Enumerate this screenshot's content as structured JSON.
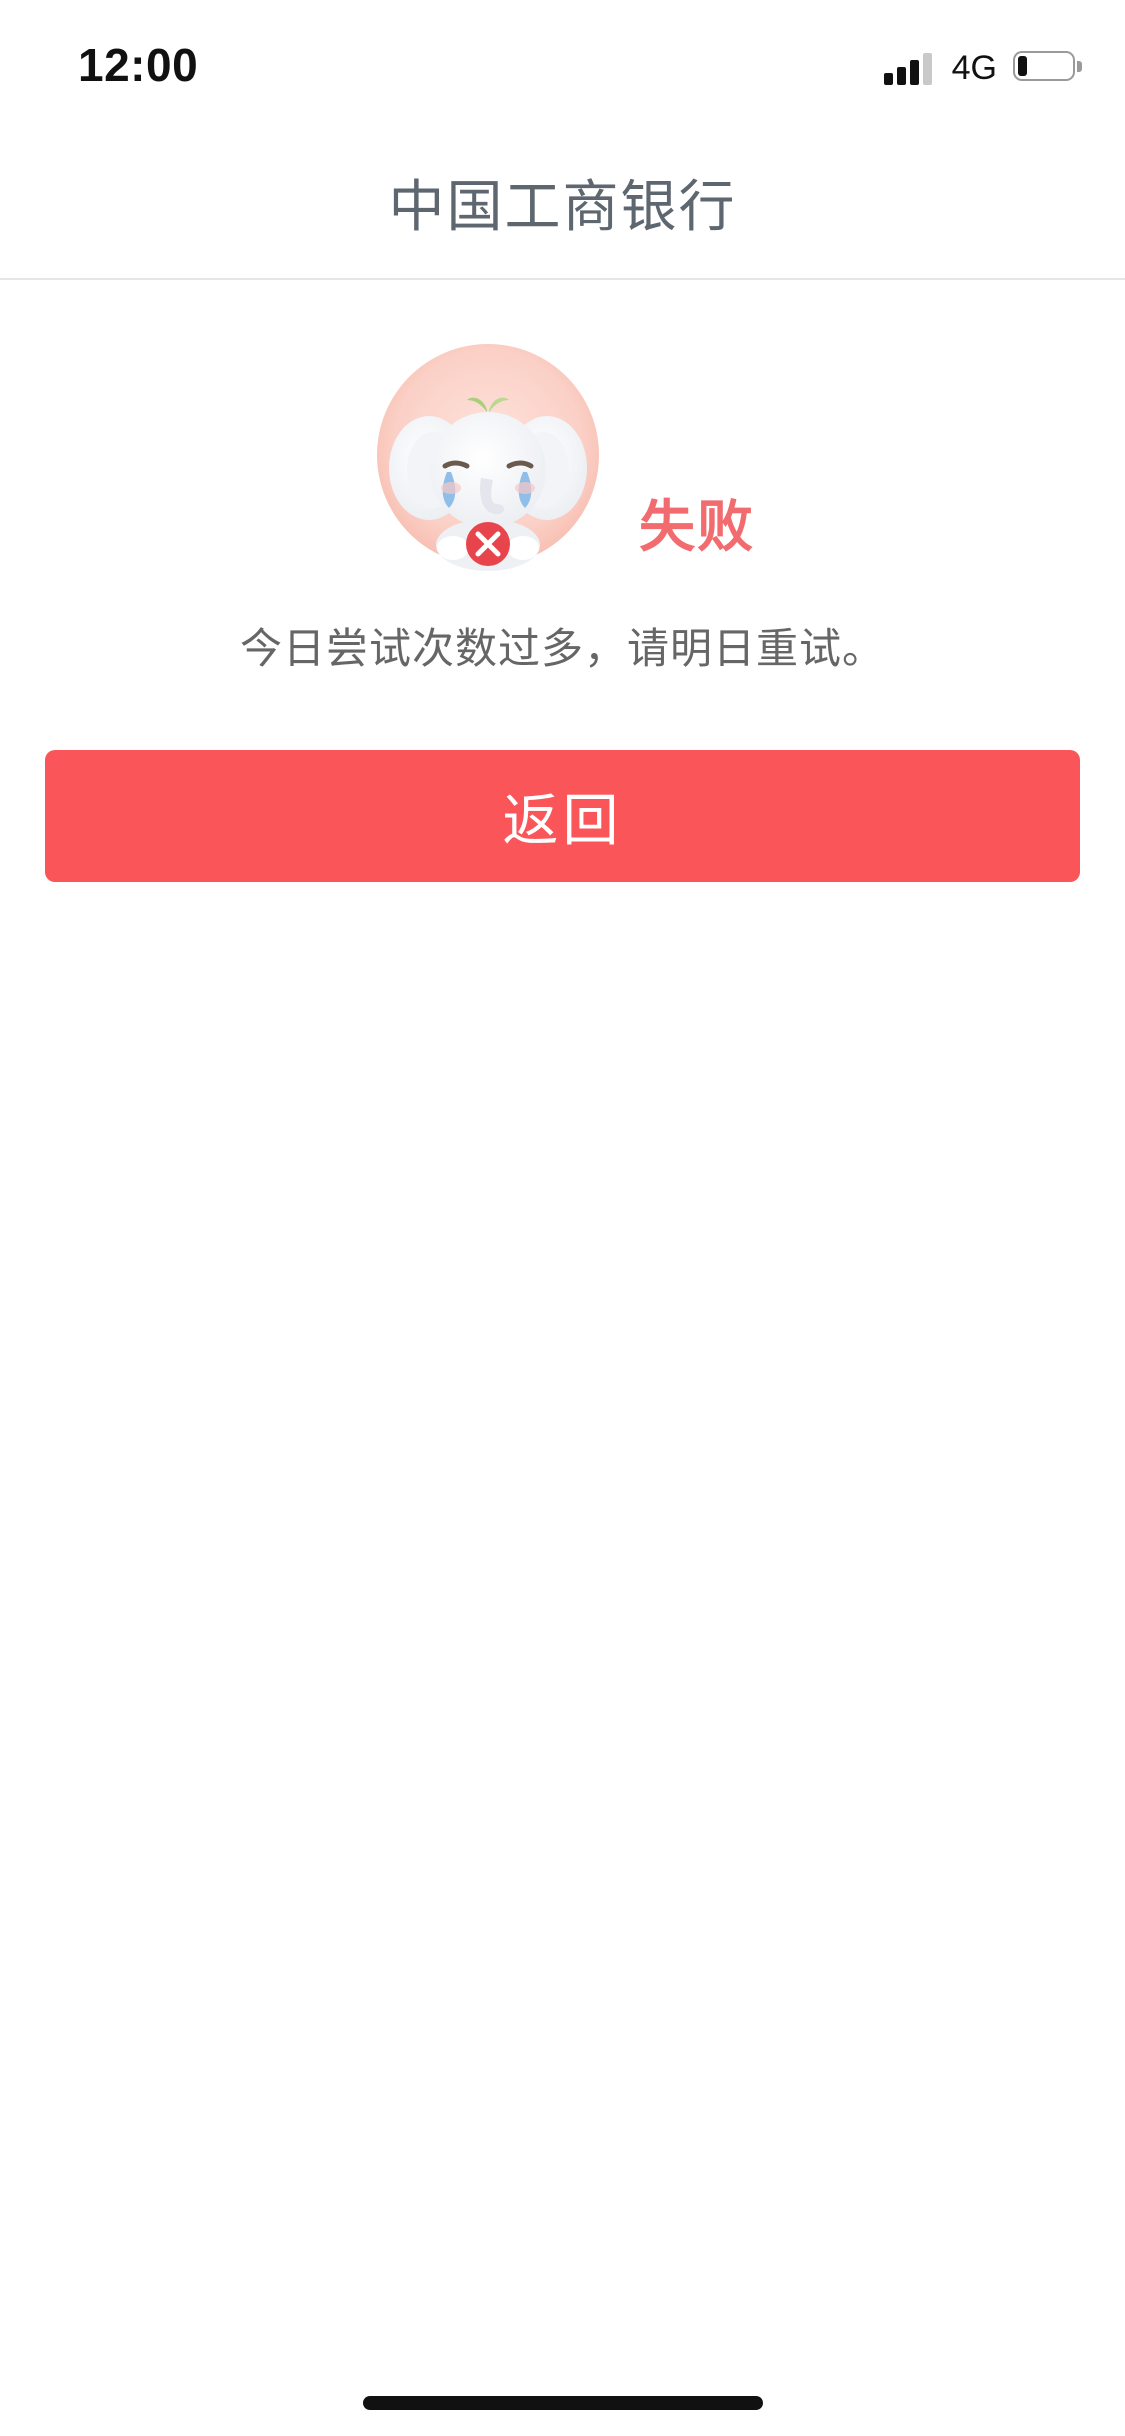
{
  "status_bar": {
    "time": "12:00",
    "network": "4G",
    "signal_icon": "signal-bars-icon",
    "battery_icon": "battery-low-icon",
    "signal_level": 0.75,
    "battery_level": 0.15
  },
  "nav": {
    "title": "中国工商银行"
  },
  "result": {
    "mascot_icon": "crying-elephant-failure-icon",
    "status_title": "失败",
    "message": "今日尝试次数过多，请明日重试。"
  },
  "actions": {
    "back_label": "返回"
  },
  "colors": {
    "accent": "#fa5558",
    "status_title": "#f26b6e",
    "nav_title": "#5e6670",
    "message_text": "#666666"
  }
}
